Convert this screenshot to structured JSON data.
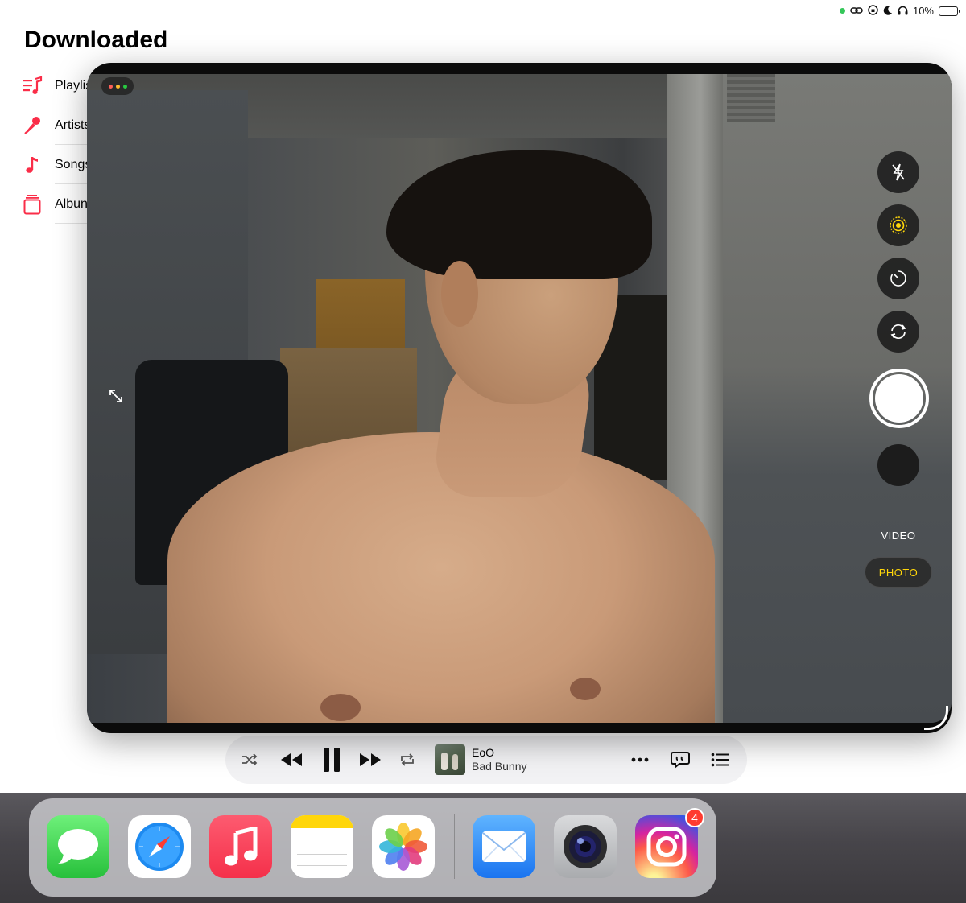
{
  "status_bar": {
    "battery_text": "10%",
    "battery_level": 0.1,
    "indicators": [
      "green-dot",
      "link-icon",
      "screen-lock-icon",
      "moon-icon",
      "headphones-icon"
    ]
  },
  "music": {
    "title": "Downloaded",
    "library_items": [
      {
        "label": "Playlis",
        "icon": "playlist-icon"
      },
      {
        "label": "Artists",
        "icon": "microphone-icon"
      },
      {
        "label": "Songs",
        "icon": "music-note-icon"
      },
      {
        "label": "Albun",
        "icon": "album-icon"
      }
    ],
    "accent_color": "#fa2d48"
  },
  "mini_player": {
    "song_title": "EoO",
    "artist": "Bad Bunny",
    "state": "playing",
    "controls": [
      "shuffle-icon",
      "rewind-icon",
      "pause-icon",
      "fast-forward-icon",
      "repeat-icon",
      "more-icon",
      "lyrics-icon",
      "queue-icon"
    ]
  },
  "camera": {
    "controls": [
      "flash-off-icon",
      "live-photo-icon",
      "timer-icon",
      "flip-camera-icon"
    ],
    "modes": {
      "video": "VIDEO",
      "photo": "PHOTO"
    },
    "active_mode": "PHOTO",
    "active_mode_color": "#ffd60a"
  },
  "dock": {
    "apps": [
      {
        "name": "Messages",
        "icon": "messages-icon"
      },
      {
        "name": "Safari",
        "icon": "safari-icon"
      },
      {
        "name": "Music",
        "icon": "music-icon"
      },
      {
        "name": "Notes",
        "icon": "notes-icon"
      },
      {
        "name": "Photos",
        "icon": "photos-icon"
      },
      {
        "name": "Mail",
        "icon": "mail-icon"
      },
      {
        "name": "Camera",
        "icon": "camera-icon"
      },
      {
        "name": "Instagram",
        "icon": "instagram-icon",
        "badge": "4"
      }
    ]
  }
}
